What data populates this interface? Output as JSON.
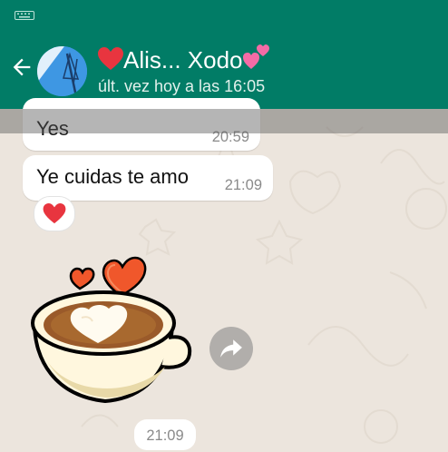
{
  "header": {
    "contact_name": "Alis... Xodo",
    "contact_status": "últ. vez hoy a las 16:05",
    "icons": [
      "keyboard-icon",
      "back-arrow-icon",
      "heart-emoji",
      "two-hearts-emoji"
    ]
  },
  "messages": [
    {
      "text": "Yes",
      "time": "20:59"
    },
    {
      "text": "Ye cuidas te amo",
      "time": "21:09",
      "reaction": "heart-emoji"
    }
  ],
  "sticker": {
    "description_icon": "coffee-heart-sticker",
    "time": "21:09",
    "forward_icon": "forward-icon"
  },
  "colors": {
    "header": "#017C66",
    "background": "#ECE5DD",
    "bubble": "#FFFFFF",
    "heart": "#E8353F"
  }
}
